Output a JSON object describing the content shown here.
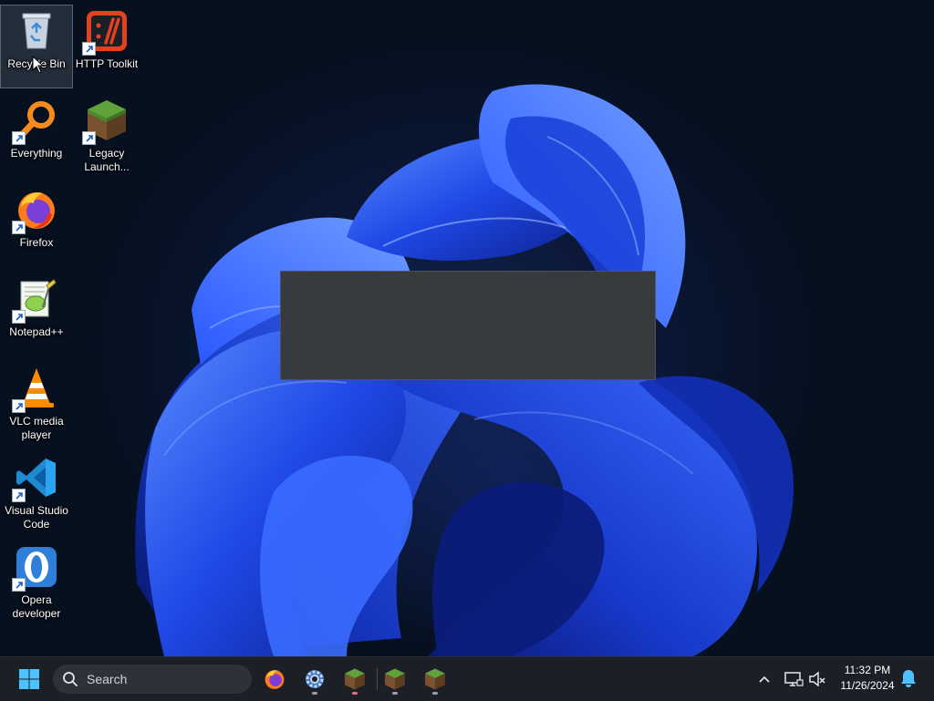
{
  "desktop": {
    "icons": [
      {
        "label": "Recycle Bin",
        "icon": "recycle-bin-icon",
        "selected": true
      },
      {
        "label": "HTTP Toolkit",
        "icon": "http-toolkit-icon"
      },
      {
        "label": "Everything",
        "icon": "everything-search-icon"
      },
      {
        "label": "Legacy Launch...",
        "icon": "minecraft-grass-block-icon"
      },
      {
        "label": "Firefox",
        "icon": "firefox-icon"
      },
      {
        "label": "Notepad++",
        "icon": "notepad-plus-plus-icon"
      },
      {
        "label": "VLC media player",
        "icon": "vlc-cone-icon"
      },
      {
        "label": "Visual Studio Code",
        "icon": "vscode-icon"
      },
      {
        "label": "Opera developer",
        "icon": "opera-icon"
      }
    ]
  },
  "taskbar": {
    "search_placeholder": "Search",
    "pinned": [
      {
        "icon": "windows-start-icon"
      },
      {
        "icon": "firefox-icon"
      },
      {
        "icon": "settings-gear-icon",
        "running": true
      },
      {
        "icon": "minecraft-grass-block-icon",
        "running": true,
        "indicator_color": "#e8736b"
      },
      {
        "icon": "minecraft-grass-block-icon",
        "running": true
      },
      {
        "icon": "minecraft-grass-block-icon",
        "running": true
      }
    ],
    "tray": {
      "time": "11:32 PM",
      "date": "11/26/2024",
      "icons": [
        "chevron-up-icon",
        "network-icon",
        "volume-muted-icon",
        "notification-bell-icon"
      ]
    }
  }
}
